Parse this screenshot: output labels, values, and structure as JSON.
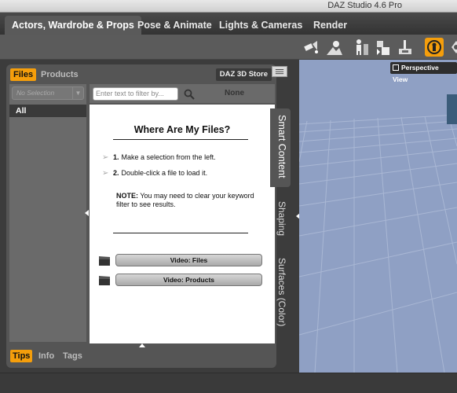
{
  "window": {
    "title": "DAZ Studio 4.6 Pro"
  },
  "tabs": [
    {
      "label": "Actors, Wardrobe & Props",
      "active": true
    },
    {
      "label": "Pose & Animate",
      "active": false
    },
    {
      "label": "Lights & Cameras",
      "active": false
    },
    {
      "label": "Render",
      "active": false
    }
  ],
  "toolbar": {
    "icons": [
      "spotlight-icon",
      "distant-light-icon",
      "figure-icon",
      "figure-swap-icon",
      "node-icon",
      "active-pose-tool-icon",
      "universal-tool-icon"
    ]
  },
  "content_library": {
    "tabs": {
      "files": "Files",
      "products": "Products"
    },
    "store_button": "DAZ 3D Store",
    "selector_placeholder": "No Selection",
    "category_all": "All",
    "filter_placeholder": "Enter text to filter by...",
    "filter_status": "None",
    "help": {
      "title": "Where Are My Files?",
      "step1_num": "1.",
      "step1_text": "Make a selection from the left.",
      "step2_num": "2.",
      "step2_text": "Double-click a file to load it.",
      "note_label": "NOTE:",
      "note_text": "You may need to clear your keyword filter to see results.",
      "video_files": "Video: Files",
      "video_products": "Video:  Products"
    }
  },
  "side_tabs": [
    {
      "label": "Smart Content",
      "active": true
    },
    {
      "label": "Shaping",
      "active": false
    },
    {
      "label": "Surfaces (Color)",
      "active": false
    }
  ],
  "bottom_tabs": [
    {
      "label": "Tips",
      "active": true
    },
    {
      "label": "Info",
      "active": false
    },
    {
      "label": "Tags",
      "active": false
    }
  ],
  "viewport": {
    "camera_label": "Perspective View"
  },
  "colors": {
    "accent": "#f59e0b",
    "viewport_bg": "#8fa0c4",
    "grid": "#a9b7d4"
  }
}
